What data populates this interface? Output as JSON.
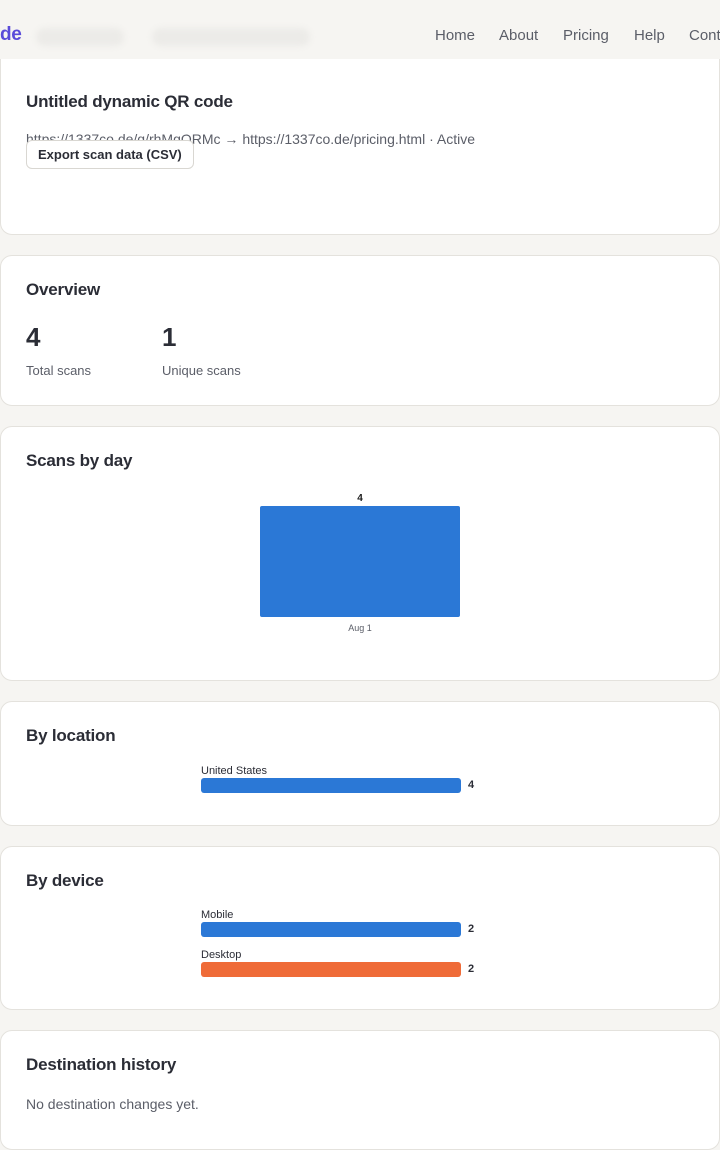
{
  "nav": {
    "logo_text": "de",
    "links": [
      "Home",
      "About",
      "Pricing",
      "Help",
      "Cont"
    ]
  },
  "qr": {
    "title": "Untitled dynamic QR code",
    "details": "https://1337co.de/q/rhMgQRMc → https://1337co.de/pricing.html · Active",
    "export_label": "Export scan data (CSV)"
  },
  "overview": {
    "title": "Overview",
    "total_scans": "4",
    "total_scans_label": "Total scans",
    "unique_scans": "1",
    "unique_scans_label": "Unique scans"
  },
  "scans_by_day": {
    "title": "Scans by day"
  },
  "by_location": {
    "title": "By location"
  },
  "by_device": {
    "title": "By device"
  },
  "destination_history": {
    "title": "Destination history",
    "empty_message": "No destination changes yet."
  },
  "colors": {
    "accent": "#5a4bd9",
    "bar_blue": "#2b78d6",
    "bar_orange": "#ef6b38"
  },
  "chart_data": [
    {
      "type": "bar",
      "title": "Scans by day",
      "categories": [
        "Aug 1"
      ],
      "values": [
        4
      ],
      "data_labels": [
        "4"
      ]
    },
    {
      "type": "bar",
      "orientation": "horizontal",
      "title": "By location",
      "categories": [
        "United States"
      ],
      "values": [
        4
      ],
      "data_labels": [
        "4"
      ]
    },
    {
      "type": "bar",
      "orientation": "horizontal",
      "title": "By device",
      "categories": [
        "Mobile",
        "Desktop"
      ],
      "values": [
        2,
        2
      ],
      "data_labels": [
        "2",
        "2"
      ]
    }
  ]
}
